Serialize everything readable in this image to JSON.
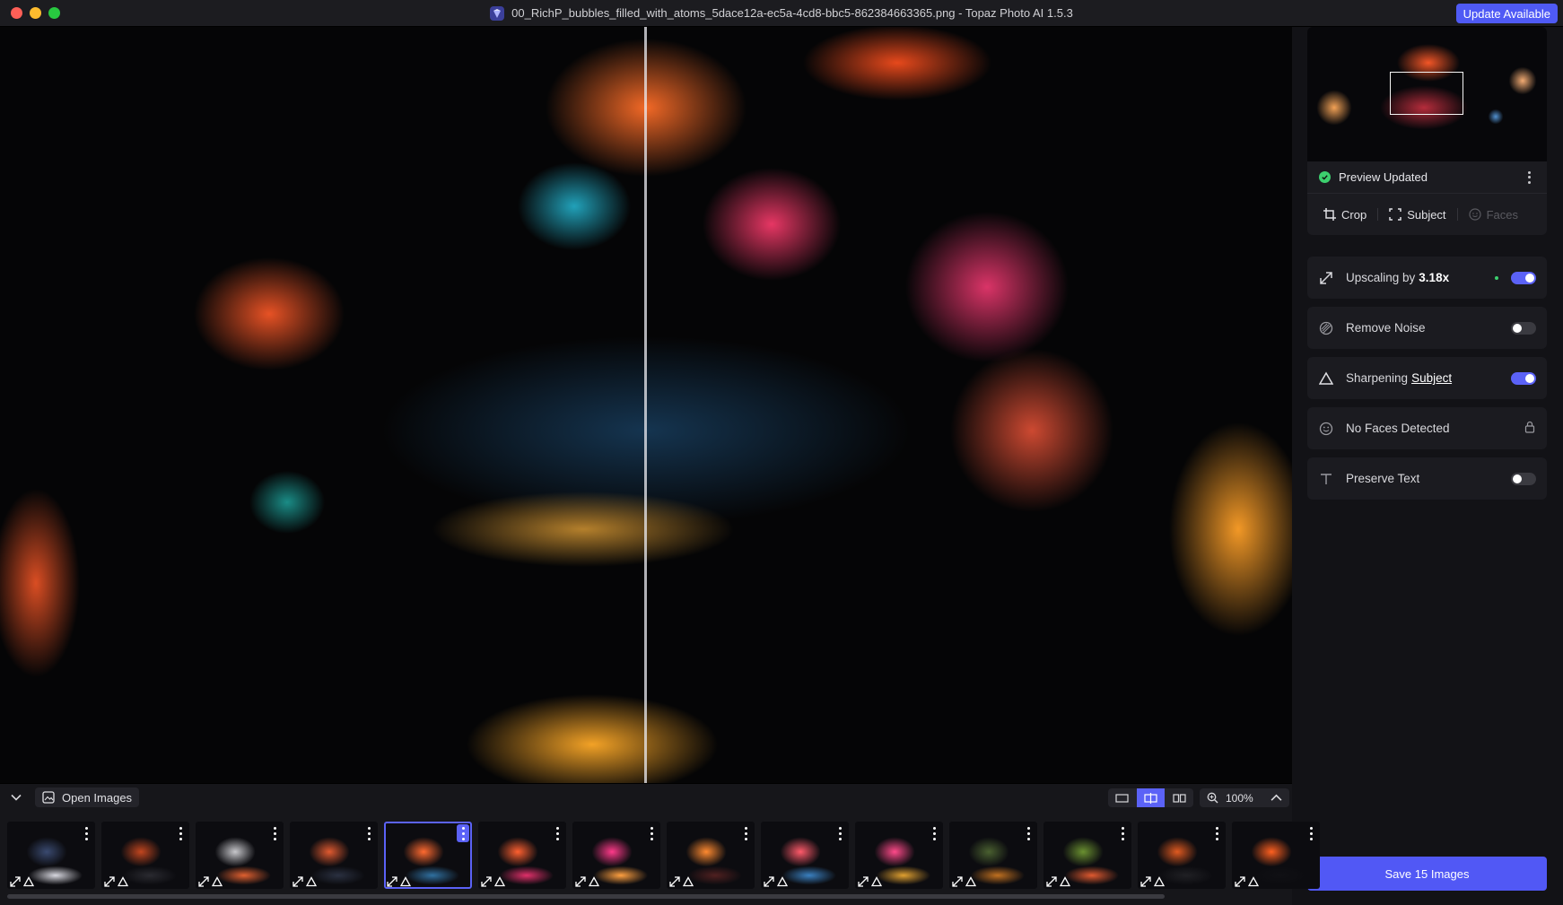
{
  "window": {
    "title": "00_RichP_bubbles_filled_with_atoms_5dace12a-ec5a-4cd8-bbc5-862384663365.png - Topaz Photo AI 1.5.3",
    "update_label": "Update Available"
  },
  "icons": {
    "app": "topaz-gem-icon",
    "status": "check-circle-icon",
    "crop": "crop-icon",
    "subject": "subject-frame-icon",
    "faces": "face-icon",
    "upscale": "expand-arrows-icon",
    "noise": "noise-icon",
    "sharpen": "triangle-icon",
    "face_detect": "smiley-icon",
    "text": "text-t-icon",
    "lock": "lock-icon",
    "open_images": "image-icon",
    "zoom": "magnifier-icon"
  },
  "colors": {
    "accent": "#5158f5",
    "toggle_on": "#5b62f7",
    "status_green": "#3ccf6e"
  },
  "preview": {
    "status": "Preview Updated"
  },
  "tools": {
    "crop": "Crop",
    "subject": "Subject",
    "faces": "Faces"
  },
  "panels": {
    "upscale": {
      "prefix": "Upscaling by",
      "value": "3.18x",
      "enabled": true
    },
    "noise": {
      "label": "Remove Noise",
      "enabled": false
    },
    "sharpen": {
      "label": "Sharpening",
      "link": "Subject",
      "enabled": true
    },
    "faces": {
      "label": "No Faces Detected",
      "locked": true
    },
    "text": {
      "label": "Preserve Text",
      "enabled": false
    }
  },
  "save": {
    "label": "Save 15 Images"
  },
  "filmstrip": {
    "open_label": "Open Images",
    "zoom": "100%",
    "view_modes": [
      "single",
      "split",
      "side-by-side"
    ],
    "active_view": "split",
    "selected_index": 4,
    "thumbs": [
      {
        "c1": "#3a4a70",
        "c2": "#d8d8e0"
      },
      {
        "c1": "#c2461f",
        "c2": "#2a2a30"
      },
      {
        "c1": "#c8c8cc",
        "c2": "#e06030"
      },
      {
        "c1": "#e05a30",
        "c2": "#2a3040"
      },
      {
        "c1": "#ff6a30",
        "c2": "#3070a0"
      },
      {
        "c1": "#ff6030",
        "c2": "#e0306a"
      },
      {
        "c1": "#ff3a8a",
        "c2": "#ffa040"
      },
      {
        "c1": "#ff8a30",
        "c2": "#502020"
      },
      {
        "c1": "#ff5a6a",
        "c2": "#3a80c0"
      },
      {
        "c1": "#ff4a8a",
        "c2": "#e0a030"
      },
      {
        "c1": "#4a6030",
        "c2": "#c07020"
      },
      {
        "c1": "#6a9030",
        "c2": "#e05a30"
      },
      {
        "c1": "#e05a20",
        "c2": "#202024"
      },
      {
        "c1": "#ff6020",
        "c2": "#101014"
      }
    ]
  }
}
